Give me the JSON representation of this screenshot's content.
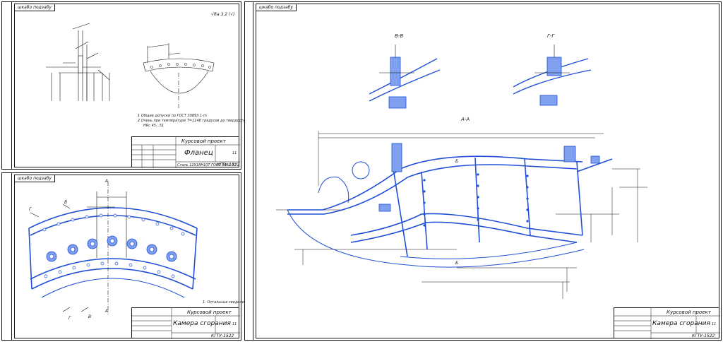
{
  "sheet_flange": {
    "stamp": "шкабо подзабу",
    "roughness": "√Ra 3.2 (√)",
    "notes": [
      "1 Общие допуски по ГОСТ 30893.1-m",
      "2 Очень при температуре Т=1148 градусов до твердости",
      "HRc 45...51"
    ],
    "title_block": {
      "course": "Курсовой проект",
      "name": "Фланец",
      "material": "Сталь 12Х18Н10Т ГОСТ 5632-72",
      "code": "КГТУ-1522",
      "sheet_count": "11"
    }
  },
  "sheet_liner": {
    "stamp": "шкабо подзабу",
    "section_marks": [
      "Г",
      "В",
      "А",
      "Г",
      "В",
      "А"
    ],
    "note": "1. Остальные сведения ...",
    "title_block": {
      "course": "Курсовой проект",
      "name": "Камера сгорания",
      "code": "КГТУ-1522",
      "sheet_count": "11"
    }
  },
  "sheet_chamber": {
    "stamp": "шкабо подзабу",
    "views": {
      "bb": "В-В",
      "gg": "Г-Г",
      "aa": "А-А",
      "b_mark_top": "Б",
      "b_mark_bottom": "Б"
    },
    "title_block": {
      "course": "Курсовой проект",
      "name": "Камера сгорания",
      "code": "КГТУ-1522",
      "sheet_count": "11"
    }
  },
  "colors": {
    "line": "#111111",
    "highlight": "#1f4fd6",
    "highlight_fill": "#7fa0ee"
  }
}
